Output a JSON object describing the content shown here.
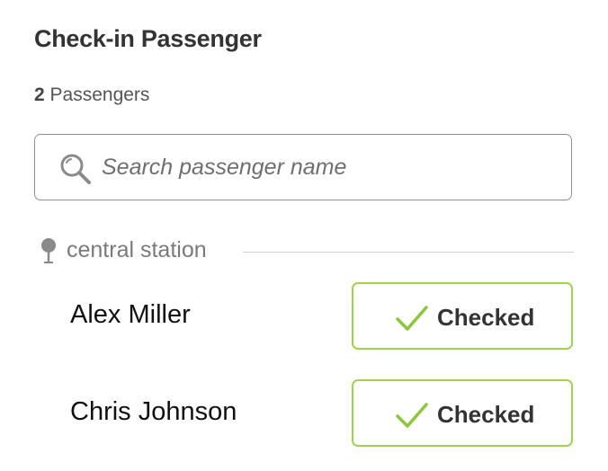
{
  "header": {
    "title": "Check-in Passenger",
    "passenger_count": "2",
    "passenger_count_label": "Passengers"
  },
  "search": {
    "placeholder": "Search passenger name",
    "value": "",
    "icon": "search-icon"
  },
  "station": {
    "name": "central station",
    "icon": "pin-icon"
  },
  "passengers": [
    {
      "name": "Alex Miller",
      "status_label": "Checked",
      "status_icon": "checkmark-icon"
    },
    {
      "name": "Chris Johnson",
      "status_label": "Checked",
      "status_icon": "checkmark-icon"
    }
  ],
  "colors": {
    "accent_green": "#9ed352",
    "check_green": "#8cc63f",
    "title_text": "#333333",
    "muted_text": "#7a7a7a",
    "border_gray": "#8f8f8f"
  }
}
